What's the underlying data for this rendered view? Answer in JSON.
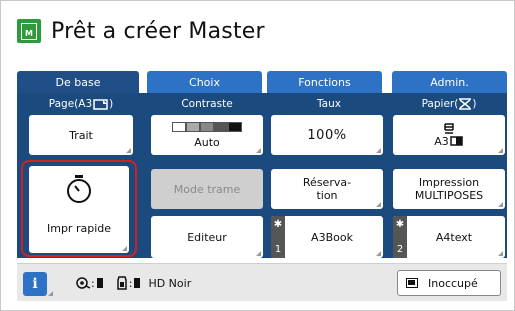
{
  "header": {
    "title": "Prêt a créer Master",
    "icon_letter": "M"
  },
  "tabs": [
    {
      "label": "De base",
      "active": true
    },
    {
      "label": "Choix",
      "active": false
    },
    {
      "label": "Fonctions",
      "active": false
    },
    {
      "label": "Admin.",
      "active": false
    }
  ],
  "columns": {
    "page": "Page(A3",
    "contraste": "Contraste",
    "taux": "Taux",
    "papier": "Papier(",
    "papier_close": ")"
  },
  "row1": {
    "page_value": "Trait",
    "contrast_value": "Auto",
    "taux_value": "100%",
    "papier_value": "A3"
  },
  "row2": {
    "quick_label": "Impr rapide",
    "mode_trame": "Mode trame",
    "reservation_line1": "Réserva-",
    "reservation_line2": "tion",
    "multi_line1": "Impression",
    "multi_line2": "MULTIPOSES"
  },
  "row3": {
    "editeur": "Editeur",
    "mem1_num": "1",
    "mem1_label": "A3Book",
    "mem2_num": "2",
    "mem2_label": "A4text"
  },
  "footer": {
    "info": "i",
    "ink_label": "HD Noir",
    "busy_label": "Inoccupé"
  },
  "colors": {
    "accent_green": "#2e9b3a",
    "tab_active": "#1f4f86",
    "tab_inactive": "#2d72c5",
    "panel": "#1a4a7e",
    "highlight": "#d32020"
  }
}
